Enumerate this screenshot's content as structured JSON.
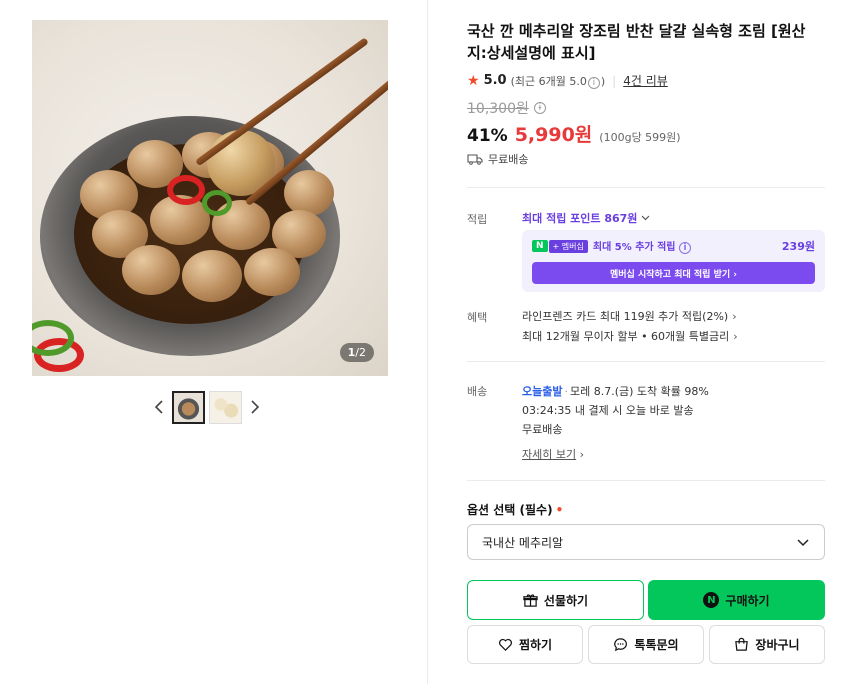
{
  "gallery": {
    "counter_current": "1",
    "counter_total": "/2",
    "prev_icon": "chevron-left",
    "next_icon": "chevron-right"
  },
  "product": {
    "title": "국산 깐 메추리알 장조림 반찬 달걀 실속형 조림 [원산지:상세설명에 표시]",
    "rating": "5.0",
    "recent_rating": "(최근 6개월 5.0",
    "recent_rating_close": ")",
    "review_count": "4건 리뷰",
    "original_price": "10,300원",
    "discount_rate": "41%",
    "sale_price": "5,990원",
    "unit_price": "(100g당 599원)",
    "shipping_badge": "무료배송"
  },
  "points": {
    "label": "적립",
    "max_points": "최대 적립 포인트 867원",
    "membership_n": "N",
    "membership_plus": "+ 멤버십",
    "membership_text": "최대 5% 추가 적립",
    "membership_points": "239원",
    "membership_button": "멤버십 시작하고 최대 적립 받기 ›"
  },
  "benefits": {
    "label": "혜택",
    "card": "라인프렌즈 카드 최대 119원 추가 적립(2%)",
    "installment": "최대 12개월 무이자 할부 • 60개월 특별금리"
  },
  "delivery": {
    "label": "배송",
    "today": "오늘출발",
    "arrival": "모레 8.7.(금) 도착 확률 98%",
    "cutoff": "03:24:35 내 결제 시 오늘 바로 발송",
    "fee": "무료배송",
    "detail_link": "자세히 보기"
  },
  "options": {
    "label": "옵션 선택 (필수)",
    "required_mark": "•",
    "selected": "국내산 메추리알"
  },
  "actions": {
    "gift": "선물하기",
    "buy": "구매하기",
    "buy_badge": "N",
    "wish": "찜하기",
    "talk": "톡톡문의",
    "cart": "장바구니"
  },
  "colors": {
    "naver_green": "#03c75a",
    "sale_red": "#e83a3a",
    "membership_purple": "#6a3fe0",
    "star": "#f04c2c"
  }
}
